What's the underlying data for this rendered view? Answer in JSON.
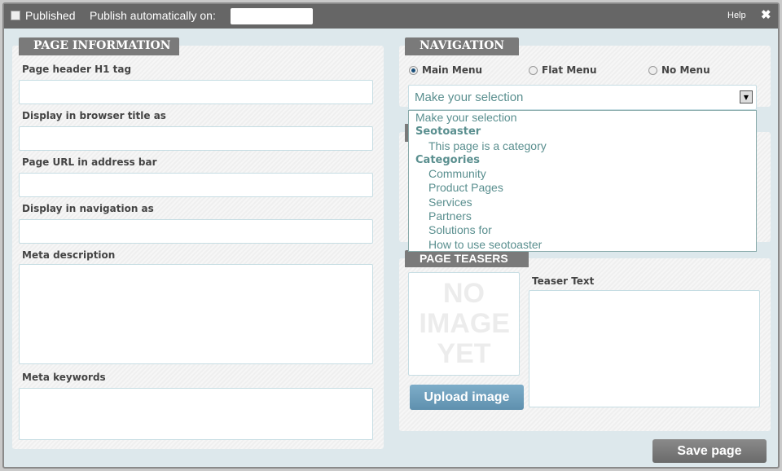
{
  "titlebar": {
    "published_label": "Published",
    "publish_auto_label": "Publish automatically on:",
    "publish_date_value": "",
    "help_label": "Help",
    "close_icon": "close-icon"
  },
  "page_info": {
    "tab": "PAGE INFORMATION",
    "fields": [
      {
        "label": "Page header H1 tag",
        "value": ""
      },
      {
        "label": "Display in browser title as",
        "value": ""
      },
      {
        "label": "Page URL in address bar",
        "value": ""
      },
      {
        "label": "Display in navigation as",
        "value": ""
      },
      {
        "label": "Meta description",
        "value": ""
      },
      {
        "label": "Meta keywords",
        "value": ""
      }
    ]
  },
  "navigation": {
    "tab": "NAVIGATION",
    "radios": [
      {
        "label": "Main Menu",
        "checked": true
      },
      {
        "label": "Flat Menu",
        "checked": false
      },
      {
        "label": "No Menu",
        "checked": false
      }
    ],
    "select_value": "Make your selection",
    "options": [
      {
        "label": "Make your selection",
        "type": "option"
      },
      {
        "label": "Seotoaster",
        "type": "group"
      },
      {
        "label": "This page is a category",
        "type": "sub"
      },
      {
        "label": "Categories",
        "type": "group"
      },
      {
        "label": "Community",
        "type": "sub"
      },
      {
        "label": "Product Pages",
        "type": "sub"
      },
      {
        "label": "Services",
        "type": "sub"
      },
      {
        "label": "Partners",
        "type": "sub"
      },
      {
        "label": "Solutions for",
        "type": "sub"
      },
      {
        "label": "How to use seotoaster",
        "type": "sub"
      }
    ]
  },
  "teasers": {
    "tab": "PAGE TEASERS",
    "placeholder_image_text": "NO IMAGE YET",
    "upload_label": "Upload image",
    "teaser_label": "Teaser Text",
    "teaser_value": ""
  },
  "save_label": "Save page",
  "colors": {
    "titlebar": "#666666",
    "body": "#dde8ec",
    "accent_button": "#6a9ab8",
    "option_text": "#5a8f8f"
  }
}
